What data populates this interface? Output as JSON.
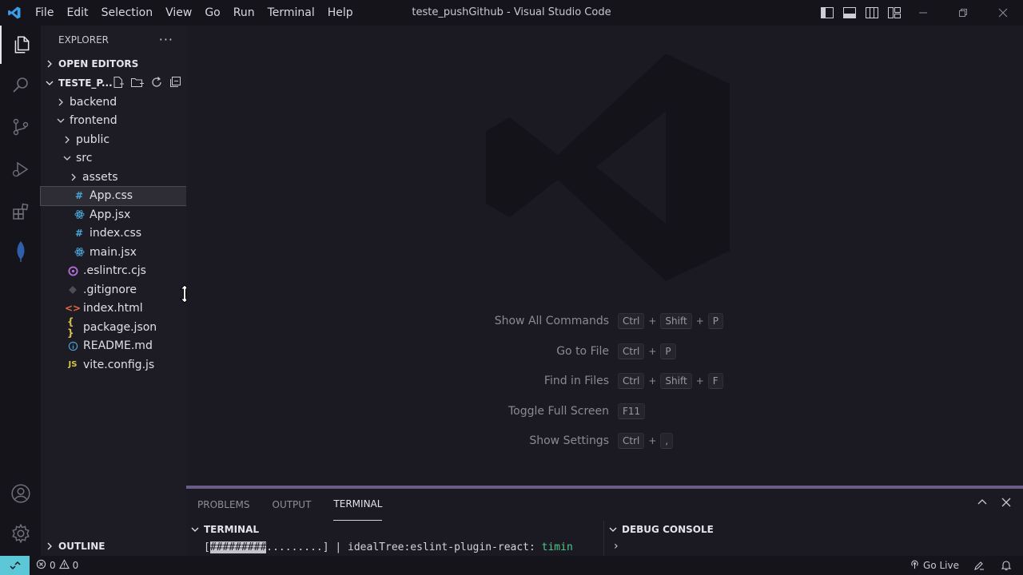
{
  "window": {
    "title": "teste_pushGithub - Visual Studio Code"
  },
  "menu": [
    "File",
    "Edit",
    "Selection",
    "View",
    "Go",
    "Run",
    "Terminal",
    "Help"
  ],
  "sidebar": {
    "header": "EXPLORER",
    "more": "···",
    "open_editors": "OPEN EDITORS",
    "project": "TESTE_P...",
    "tree": [
      {
        "label": "backend",
        "kind": "folder",
        "expanded": false,
        "depth": 0
      },
      {
        "label": "frontend",
        "kind": "folder",
        "expanded": true,
        "depth": 0
      },
      {
        "label": "public",
        "kind": "folder",
        "expanded": false,
        "depth": 1
      },
      {
        "label": "src",
        "kind": "folder",
        "expanded": true,
        "depth": 1
      },
      {
        "label": "assets",
        "kind": "folder",
        "expanded": false,
        "depth": 2
      },
      {
        "label": "App.css",
        "kind": "css",
        "depth": 2,
        "selected": true
      },
      {
        "label": "App.jsx",
        "kind": "react",
        "depth": 2
      },
      {
        "label": "index.css",
        "kind": "css",
        "depth": 2
      },
      {
        "label": "main.jsx",
        "kind": "react",
        "depth": 2
      },
      {
        "label": ".eslintrc.cjs",
        "kind": "eslint",
        "depth": 1
      },
      {
        "label": ".gitignore",
        "kind": "git",
        "depth": 1
      },
      {
        "label": "index.html",
        "kind": "html",
        "depth": 1
      },
      {
        "label": "package.json",
        "kind": "json",
        "depth": 1
      },
      {
        "label": "README.md",
        "kind": "info",
        "depth": 1
      },
      {
        "label": "vite.config.js",
        "kind": "js",
        "depth": 1
      }
    ],
    "outline": "OUTLINE"
  },
  "editor": {
    "shortcuts": [
      {
        "label": "Show All Commands",
        "keys": [
          "Ctrl",
          "Shift",
          "P"
        ]
      },
      {
        "label": "Go to File",
        "keys": [
          "Ctrl",
          "P"
        ]
      },
      {
        "label": "Find in Files",
        "keys": [
          "Ctrl",
          "Shift",
          "F"
        ]
      },
      {
        "label": "Toggle Full Screen",
        "keys": [
          "F11"
        ]
      },
      {
        "label": "Show Settings",
        "keys": [
          "Ctrl",
          ","
        ]
      }
    ]
  },
  "panel": {
    "tabs": [
      "PROBLEMS",
      "OUTPUT",
      "TERMINAL"
    ],
    "active_tab": "TERMINAL",
    "terminal_title": "TERMINAL",
    "debug_title": "DEBUG CONSOLE",
    "terminal_line": {
      "open": "[",
      "progress": "#########",
      "rest": ".........] | idealTree:eslint-plugin-react: ",
      "status": "timin"
    },
    "debug_prompt": "›"
  },
  "statusbar": {
    "errors": "0",
    "warnings": "0",
    "go_live": "Go Live"
  },
  "colors": {
    "accent": "#5cc7d6",
    "panel_border": "#6b5b8a",
    "terminal_green": "#4ec98a"
  }
}
